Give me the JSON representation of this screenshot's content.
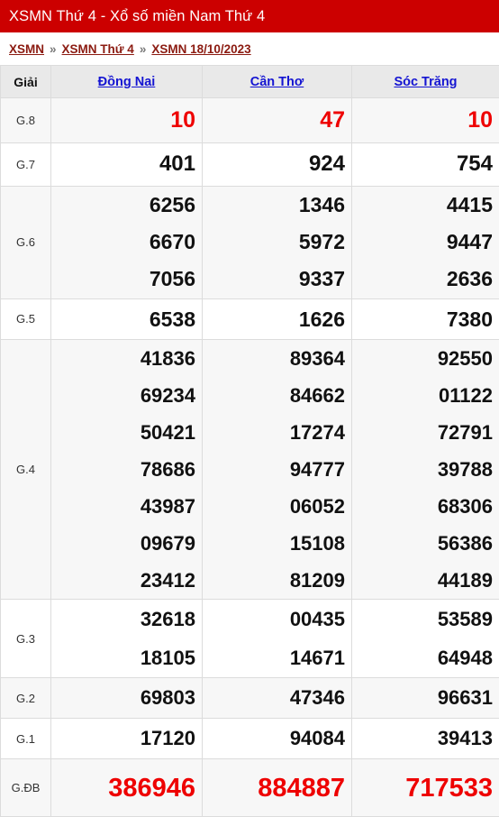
{
  "header": {
    "title": "XSMN Thứ 4 - Xổ số miền Nam Thứ 4",
    "banner_color": "#cc0000"
  },
  "breadcrumb": {
    "separator": "»",
    "items": [
      {
        "label": "XSMN"
      },
      {
        "label": "XSMN Thứ 4"
      },
      {
        "label": "XSMN 18/10/2023"
      }
    ],
    "link_color": "#8b1a10"
  },
  "table": {
    "columns": [
      {
        "label": "Giải",
        "type": "prize"
      },
      {
        "label": "Đồng Nai",
        "type": "province"
      },
      {
        "label": "Cần Thơ",
        "type": "province"
      },
      {
        "label": "Sóc Trăng",
        "type": "province"
      }
    ],
    "header_link_color": "#1414d2",
    "highlight_color": "#ee0000",
    "rows": [
      {
        "prize": "G.8",
        "dong_nai": [
          "10"
        ],
        "can_tho": [
          "47"
        ],
        "soc_trang": [
          "10"
        ]
      },
      {
        "prize": "G.7",
        "dong_nai": [
          "401"
        ],
        "can_tho": [
          "924"
        ],
        "soc_trang": [
          "754"
        ]
      },
      {
        "prize": "G.6",
        "dong_nai": [
          "6256",
          "6670",
          "7056"
        ],
        "can_tho": [
          "1346",
          "5972",
          "9337"
        ],
        "soc_trang": [
          "4415",
          "9447",
          "2636"
        ]
      },
      {
        "prize": "G.5",
        "dong_nai": [
          "6538"
        ],
        "can_tho": [
          "1626"
        ],
        "soc_trang": [
          "7380"
        ]
      },
      {
        "prize": "G.4",
        "dong_nai": [
          "41836",
          "69234",
          "50421",
          "78686",
          "43987",
          "09679",
          "23412"
        ],
        "can_tho": [
          "89364",
          "84662",
          "17274",
          "94777",
          "06052",
          "15108",
          "81209"
        ],
        "soc_trang": [
          "92550",
          "01122",
          "72791",
          "39788",
          "68306",
          "56386",
          "44189"
        ]
      },
      {
        "prize": "G.3",
        "dong_nai": [
          "32618",
          "18105"
        ],
        "can_tho": [
          "00435",
          "14671"
        ],
        "soc_trang": [
          "53589",
          "64948"
        ]
      },
      {
        "prize": "G.2",
        "dong_nai": [
          "69803"
        ],
        "can_tho": [
          "47346"
        ],
        "soc_trang": [
          "96631"
        ]
      },
      {
        "prize": "G.1",
        "dong_nai": [
          "17120"
        ],
        "can_tho": [
          "94084"
        ],
        "soc_trang": [
          "39413"
        ]
      },
      {
        "prize": "G.ĐB",
        "dong_nai": [
          "386946"
        ],
        "can_tho": [
          "884887"
        ],
        "soc_trang": [
          "717533"
        ]
      }
    ]
  }
}
